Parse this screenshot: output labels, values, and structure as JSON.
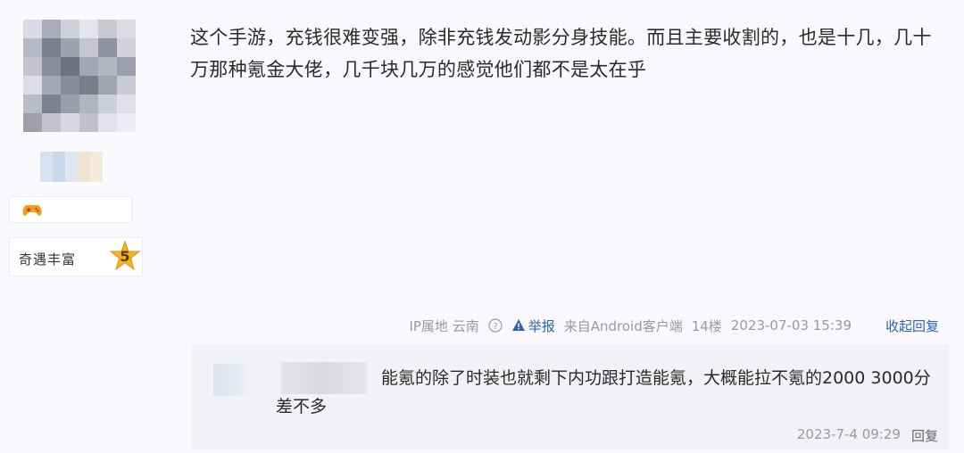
{
  "post": {
    "text": "这个手游，充钱很难变强，除非充钱发动影分身技能。而且主要收割的，也是十几，几十万那种氪金大佬，几千块几万的感觉他们都不是太在乎",
    "ip_location": "IP属地 云南",
    "report_label": "举报",
    "source": "来自Android客户端",
    "floor": "14楼",
    "timestamp": "2023-07-03 15:39",
    "collapse_label": "收起回复"
  },
  "author": {
    "level_title": "奇遇丰富",
    "level_number": "5",
    "badge_icon": "gamepad-icon"
  },
  "reply": {
    "text": "能氪的除了时装也就剩下内功跟打造能氪，大概能拉不氪的2000 3000分差不多",
    "timestamp": "2023-7-4 09:29",
    "reply_label": "回复"
  },
  "colors": {
    "link": "#2d64b3",
    "meta_gray": "#9a9a9a",
    "reply_bg": "#f1f2f6",
    "star": "#f2b41e"
  }
}
